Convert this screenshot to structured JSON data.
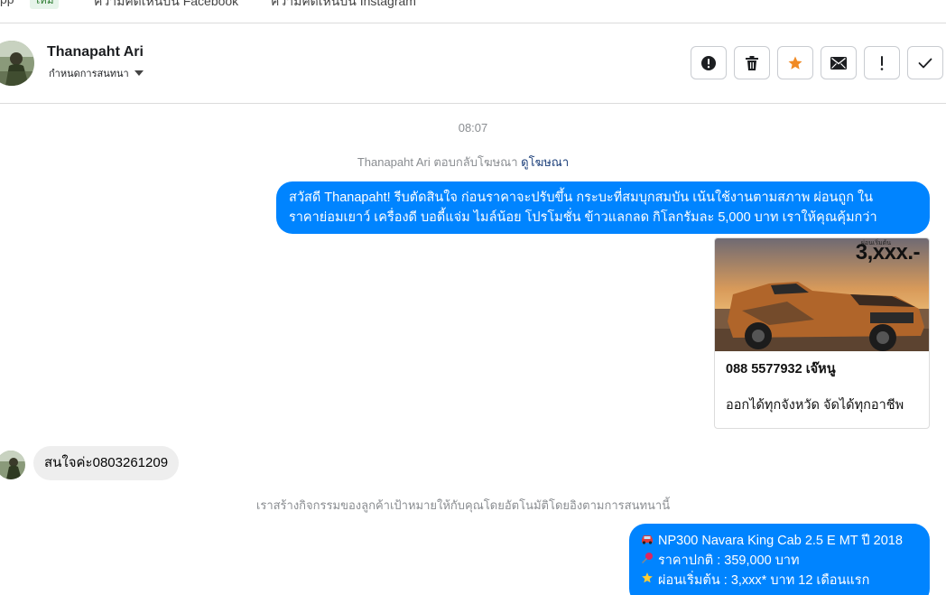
{
  "top_tabs": {
    "tab0": "pp",
    "badge": "ใหม่",
    "tab1": "ความคิดเห็นบน Facebook",
    "tab2": "ความคิดเห็นบน Instagram"
  },
  "header": {
    "contact_name": "Thanapaht Ari",
    "assign_label": "กำหนดการสนทนา",
    "actions": [
      "report-spam",
      "delete",
      "star",
      "mark-unread",
      "follow-up",
      "mark-done"
    ]
  },
  "messages": {
    "timestamp": "08:07",
    "ad_note_prefix": "Thanapaht Ari ตอบกลับโฆษณา",
    "ad_note_link": "ดูโฆษณา",
    "outgoing_1_line1": "สวัสดี Thanapaht! รีบตัดสินใจ ก่อนราคาจะปรับขึ้น กระบะที่สมบุกสมบัน เน้นใช้งานตามสภาพ ผ่อนถูก ใน",
    "outgoing_1_line2": "ราคาย่อมเยาว์ เครื่องดี บอดี้แจ่ม ไมล์น้อย โปรโมชั่น ข้าวแลกลด กิโลกรัมละ 5,000 บาท เราให้คุณคุ้มกว่า",
    "card": {
      "price_overlay": "3,xxx.-",
      "price_overlay_small": "ผ่อนเริ่มต้น",
      "phone": "088 5577932 เจ๊หนู",
      "description": "ออกได้ทุกจังหวัด จัดได้ทุกอาชีพ"
    },
    "incoming_1": "สนใจค่ะ0803261209",
    "system_note": "เราสร้างกิจกรรมของลูกค้าเป้าหมายให้กับคุณโดยอัตโนมัติโดยอิงตามการสนทนานี้",
    "outgoing_2": {
      "line1_icon": "car-icon",
      "line1": "NP300 Navara King Cab 2.5 E MT ปี 2018",
      "line2_icon": "pushpin-icon",
      "line2": "ราคาปกติ : 359,000 บาท",
      "line3_icon": "star-icon",
      "line3": "ผ่อนเริ่มต้น : 3,xxx* บาท 12 เดือนแรก"
    }
  },
  "colors": {
    "outgoing_bubble": "#0084ff",
    "incoming_bubble": "#eeeeee",
    "star_accent": "#f08a24",
    "link": "#1c3f7a"
  }
}
